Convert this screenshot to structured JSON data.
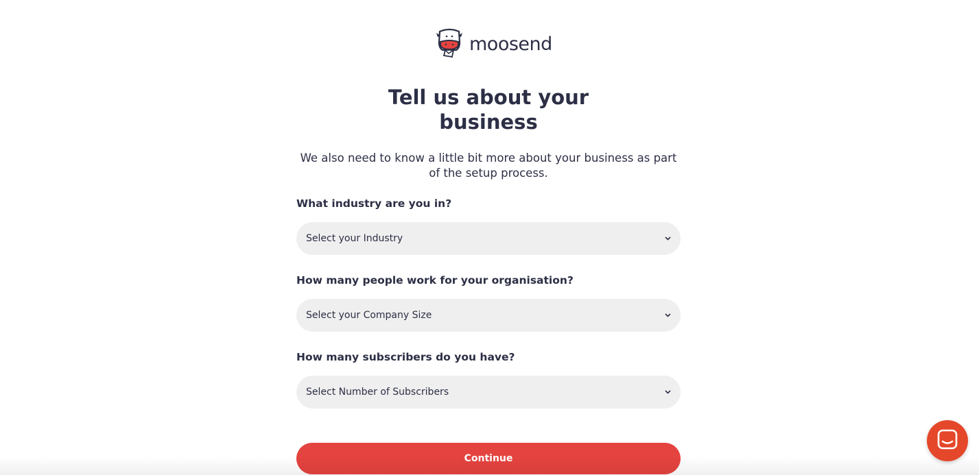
{
  "brand": {
    "name": "moosend",
    "accent_color": "#e5433f",
    "logo_icon": "cow-icon"
  },
  "header": {
    "title_line1": "Tell us about your",
    "title_line2": "business",
    "subtitle": "We also need to know a little bit more about your business as part of the setup process."
  },
  "form": {
    "industry": {
      "label": "What industry are you in?",
      "value": "Select your Industry"
    },
    "company_size": {
      "label": "How many people work for your organisation?",
      "value": "Select your Company Size"
    },
    "subscribers": {
      "label": "How many subscribers do you have?",
      "value": "Select Number of Subscribers"
    },
    "continue_label": "Continue"
  },
  "chat": {
    "icon": "chat-icon",
    "color": "#e5472a"
  }
}
